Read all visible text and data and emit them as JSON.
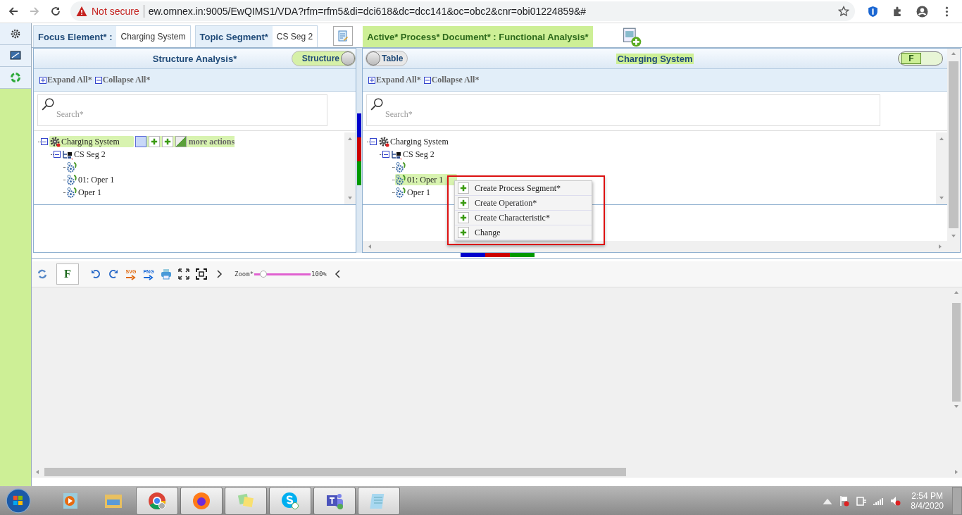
{
  "browser": {
    "warning": "Not secure",
    "url": "ew.omnex.in:9005/EwQIMS1/VDA?rfm=rfm5&di=dci618&dc=dcc141&oc=obc2&cnr=obi01224859&#"
  },
  "header": {
    "focus_label": "Focus Element* :",
    "focus_value": "Charging System",
    "topic_label": "Topic Segment*",
    "topic_value": "CS Seg 2",
    "active_tab": "Active* Process* Document* : Functional Analysis*"
  },
  "left_panel": {
    "title": "Structure Analysis*",
    "title_highlight": false,
    "toggle": {
      "label": "Structure",
      "on": true
    },
    "expand": "Expand All*",
    "collapse": "Collapse All*",
    "search_placeholder": "Search*",
    "more_actions": "more actions",
    "tree": [
      {
        "label": "Charging System",
        "kind": "system",
        "selected": true,
        "children": [
          {
            "label": "CS Seg 2",
            "kind": "segment",
            "selected": false,
            "children": [
              {
                "kind": "operation",
                "selected": false
              },
              {
                "label": "01: Oper 1",
                "kind": "operation",
                "selected": false
              },
              {
                "label": "Oper 1",
                "kind": "operation",
                "selected": false
              }
            ]
          }
        ]
      }
    ]
  },
  "right_panel": {
    "title": "Charging System",
    "title_highlight": true,
    "toggle": {
      "label": "Table",
      "on": false
    },
    "f_toggle": {
      "label": "F",
      "on": true
    },
    "expand": "Expand All*",
    "collapse": "Collapse All*",
    "search_placeholder": "Search*",
    "tree": [
      {
        "label": "Charging System",
        "kind": "system",
        "selected": false,
        "children": [
          {
            "label": "CS Seg 2",
            "kind": "segment",
            "selected": false,
            "children": [
              {
                "kind": "operation",
                "selected": false
              },
              {
                "label": "01: Oper 1",
                "kind": "operation",
                "selected": true
              },
              {
                "label": "Oper 1",
                "kind": "operation",
                "selected": false
              }
            ]
          }
        ]
      }
    ],
    "context_menu": [
      "Create Process Segment*",
      "Create Operation*",
      "Create Characteristic*",
      "Change"
    ]
  },
  "toolbar": {
    "f_label": "F",
    "svg_label": "SVG",
    "png_label": "PNG",
    "zoom_label": "Zoom*",
    "zoom": {
      "level": 0.1
    },
    "zoom_value": "100%"
  },
  "taskbar": {
    "time": "2:54 PM",
    "date": "8/4/2020"
  }
}
